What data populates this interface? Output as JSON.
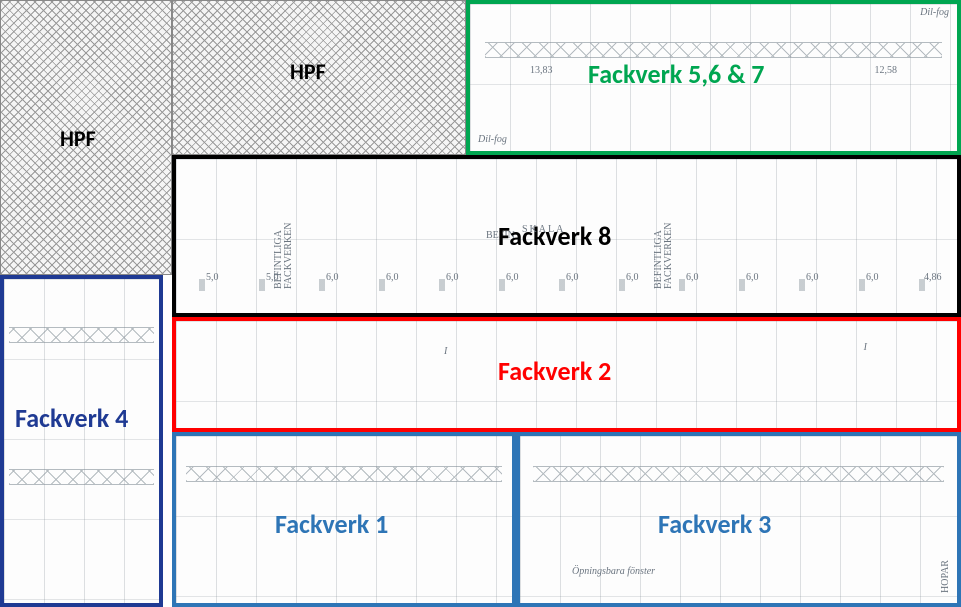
{
  "regions": {
    "hpf_left": {
      "label": "HPF"
    },
    "hpf_right": {
      "label": "HPF"
    },
    "fackverk567": {
      "label": "Fackverk 5,6 & 7",
      "color": "#00a651",
      "border": "#00a651"
    },
    "fackverk8": {
      "label": "Fackverk 8",
      "color": "#000000",
      "border": "#000000"
    },
    "fackverk2": {
      "label": "Fackverk 2",
      "color": "#ff0000",
      "border": "#ff0000"
    },
    "fackverk1": {
      "label": "Fackverk 1",
      "color": "#2e75b6",
      "border": "#2e75b6"
    },
    "fackverk3": {
      "label": "Fackverk 3",
      "color": "#2e75b6",
      "border": "#2e75b6"
    },
    "fackverk4": {
      "label": "Fackverk 4",
      "color": "#1f3a93",
      "border": "#1f3a93"
    }
  },
  "annotations": {
    "dil_fog_top": "Dil-fog",
    "dil_fog_right": "Dil-fog",
    "befintliga_left": "BEFINTLIGA FACKVERKEN",
    "befintliga_center": "BEFIN",
    "befintliga_right": "BEFINTLIGA FACKVERKEN",
    "opningsbara": "Öpningsbara fönster",
    "skala": "SKALA",
    "hopar": "HOPAR"
  },
  "dimensions_row8": [
    "5,0",
    "5,0",
    "6,0",
    "6,0",
    "6,0",
    "6,0",
    "6,0",
    "6,0",
    "6,0",
    "6,0",
    "6,0",
    "6,0",
    "4,86"
  ],
  "dimensions_row567": [
    "13,83",
    "12,58"
  ]
}
